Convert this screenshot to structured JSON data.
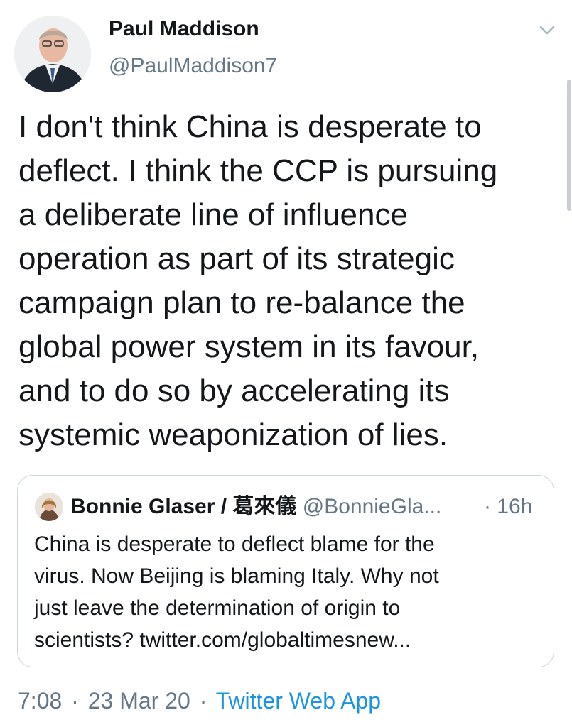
{
  "author": {
    "name": "Paul Maddison",
    "handle": "@PaulMaddison7"
  },
  "tweet": {
    "lines": [
      "I don't think China is desperate to",
      "deflect. I think the CCP is pursuing",
      "a deliberate line of influence",
      "operation as part of its strategic",
      "campaign plan to re-balance the",
      "global power system in its favour,",
      "and to do so by accelerating its",
      "systemic weaponization of lies."
    ]
  },
  "quoted": {
    "name": "Bonnie Glaser / 葛來儀",
    "handle": "@BonnieGla...",
    "time": "· 16h",
    "lines": [
      "China is desperate to deflect blame for the",
      "virus. Now Beijing is blaming Italy. Why not",
      "just leave the determination of origin to",
      "scientists? twitter.com/globaltimesnew..."
    ]
  },
  "meta": {
    "time": "7:08",
    "separator": "·",
    "date": "23 Mar 20",
    "source": "Twitter Web App"
  },
  "icons": {
    "caret": "chevron-down-icon"
  },
  "colors": {
    "text": "#14171a",
    "secondary": "#657786",
    "link": "#1b95e0",
    "border": "#ccd6dd"
  }
}
